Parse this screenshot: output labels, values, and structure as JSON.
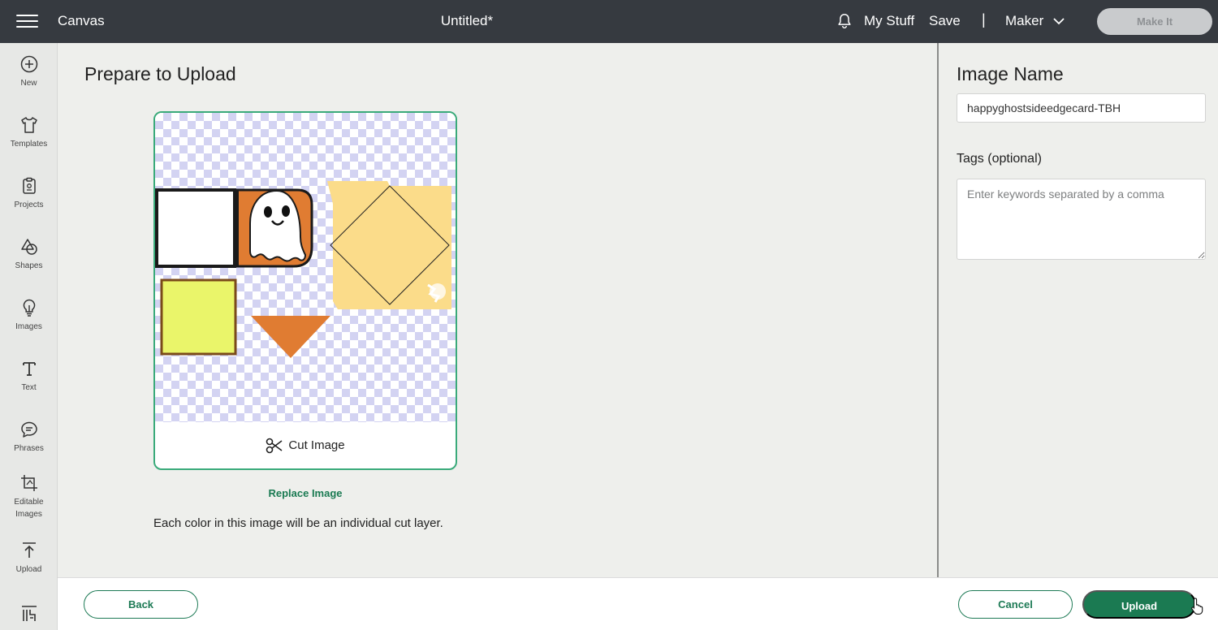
{
  "topbar": {
    "app_title": "Canvas",
    "doc_title": "Untitled*",
    "my_stuff": "My Stuff",
    "save": "Save",
    "separator": "|",
    "machine": "Maker",
    "make_it": "Make It"
  },
  "sidebar": {
    "items": [
      {
        "label": "New",
        "icon": "plus-circle-icon"
      },
      {
        "label": "Templates",
        "icon": "shirt-icon"
      },
      {
        "label": "Projects",
        "icon": "clipboard-icon"
      },
      {
        "label": "Shapes",
        "icon": "shapes-icon"
      },
      {
        "label": "Images",
        "icon": "lightbulb-icon"
      },
      {
        "label": "Text",
        "icon": "text-icon"
      },
      {
        "label": "Phrases",
        "icon": "speech-bubble-icon"
      },
      {
        "label": "Editable Images",
        "icon": "editable-image-icon"
      },
      {
        "label": "Upload",
        "icon": "upload-icon"
      },
      {
        "label": "",
        "icon": "monogram-icon"
      }
    ]
  },
  "main": {
    "title": "Prepare to Upload",
    "cut_label": "Cut Image",
    "replace_link": "Replace Image",
    "info_text": "Each color in this image will be an individual cut layer."
  },
  "panel": {
    "title": "Image Name",
    "image_name": "happyghostsideedgecard-TBH",
    "tags_label": "Tags (optional)",
    "tags_placeholder": "Enter keywords separated by a comma"
  },
  "footer": {
    "back": "Back",
    "cancel": "Cancel",
    "upload": "Upload"
  },
  "colors": {
    "topbar": "#363a40",
    "accent_green": "#1b7a52",
    "card_border": "#3aaa7a",
    "orange": "#e07c32",
    "yellow": "#eaf56a",
    "peach": "#fbdc8a"
  }
}
